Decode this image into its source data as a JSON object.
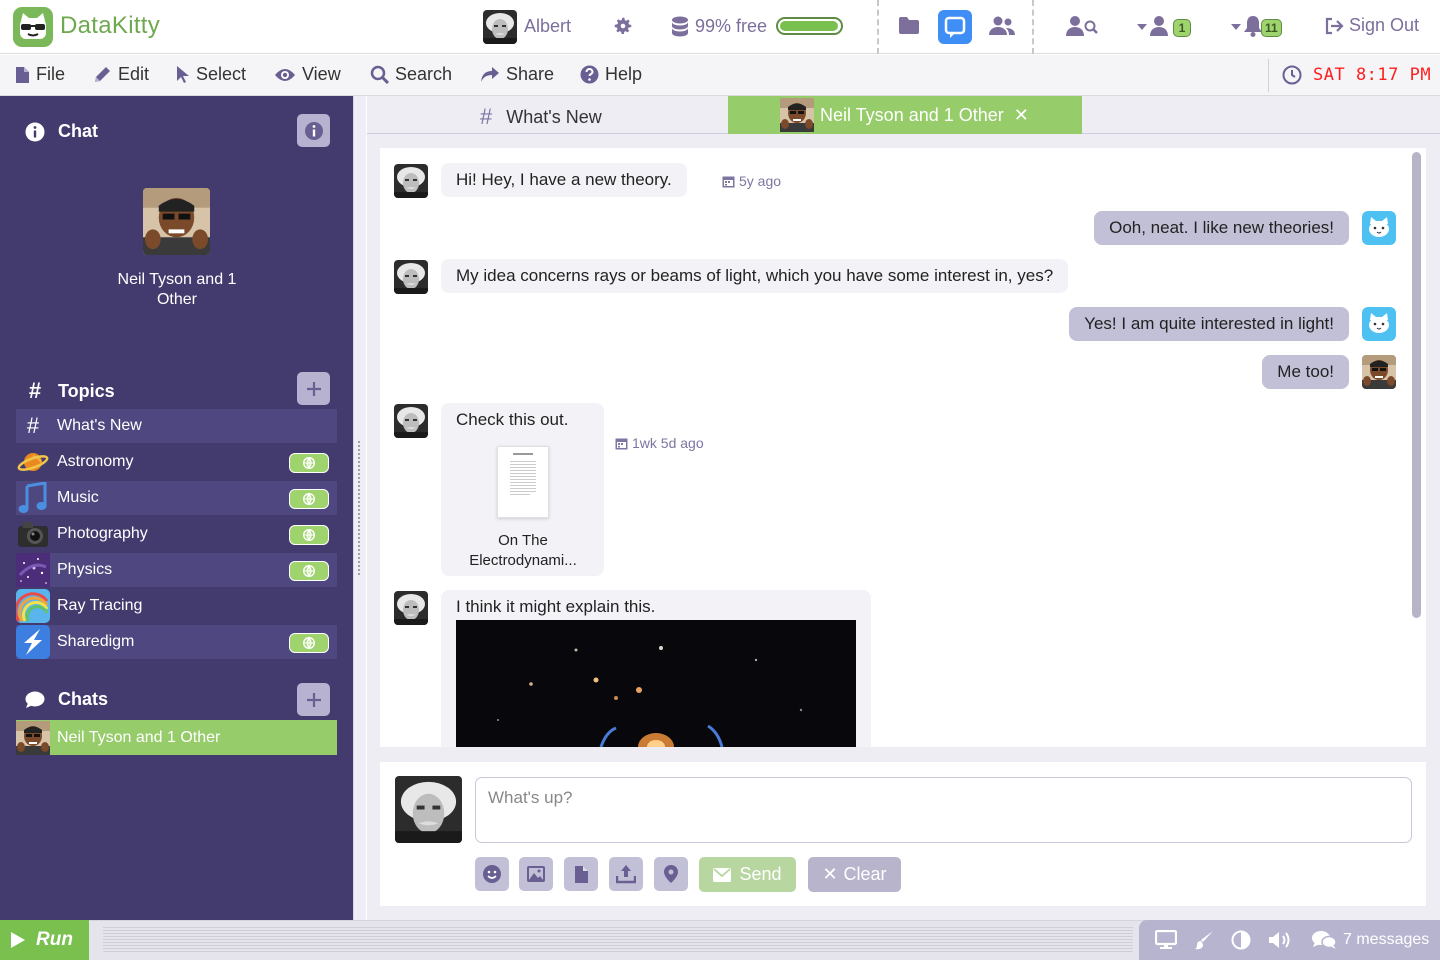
{
  "app": {
    "name": "DataKitty"
  },
  "header": {
    "user_name": "Albert",
    "storage_label": "99% free",
    "storage_fraction": 0.99,
    "friend_requests_count": "1",
    "notifications_count": "11",
    "sign_out_label": "Sign Out"
  },
  "menu": {
    "file": "File",
    "edit": "Edit",
    "select": "Select",
    "view": "View",
    "search": "Search",
    "share": "Share",
    "help": "Help"
  },
  "clock": {
    "text": "SAT 8:17 PM"
  },
  "sidebar": {
    "chat_heading": "Chat",
    "profile_name": "Neil Tyson and 1 Other",
    "topics_heading": "Topics",
    "topics": [
      {
        "label": "What's New",
        "icon": "hash-icon",
        "public": false
      },
      {
        "label": "Astronomy",
        "icon": "planet-icon",
        "public": true
      },
      {
        "label": "Music",
        "icon": "music-note-icon",
        "public": true
      },
      {
        "label": "Photography",
        "icon": "camera-icon",
        "public": true
      },
      {
        "label": "Physics",
        "icon": "galaxy-icon",
        "public": true
      },
      {
        "label": "Ray Tracing",
        "icon": "rainbow-icon",
        "public": false
      },
      {
        "label": "Sharedigm",
        "icon": "sharedigm-logo-icon",
        "public": true
      }
    ],
    "chats_heading": "Chats",
    "chats": [
      {
        "label": "Neil Tyson and 1 Other"
      }
    ]
  },
  "tabs": [
    {
      "label": "What's New",
      "active": false
    },
    {
      "label": "Neil Tyson and 1 Other",
      "active": true
    }
  ],
  "messages": [
    {
      "direction": "in",
      "sender": "Albert",
      "text": "Hi!   Hey, I have a new theory.",
      "time": "5y ago"
    },
    {
      "direction": "out",
      "sender": "Cat",
      "text": "Ooh, neat.   I like new theories!"
    },
    {
      "direction": "in",
      "sender": "Albert",
      "text": "My idea concerns rays or beams of light, which you have some interest in, yes?"
    },
    {
      "direction": "out",
      "sender": "Cat",
      "text": "Yes!  I am quite interested in light!"
    },
    {
      "direction": "out",
      "sender": "Neil",
      "text": "Me too!"
    },
    {
      "direction": "in",
      "sender": "Albert",
      "text": "Check this out.",
      "time": "1wk 5d ago",
      "attachment": "On The Electrodynami..."
    },
    {
      "direction": "in",
      "sender": "Albert",
      "text": "I think it might explain this.",
      "image": "space-photo"
    }
  ],
  "composer": {
    "placeholder": "What's up?",
    "send_label": "Send",
    "clear_label": "Clear"
  },
  "status": {
    "run_label": "Run",
    "message_count": "7 messages"
  },
  "colors": {
    "accent_green": "#96cc6a",
    "sidebar_purple": "#433b6e",
    "chat_blue": "#3f8ef5",
    "clock_red": "#ff1e1e"
  }
}
